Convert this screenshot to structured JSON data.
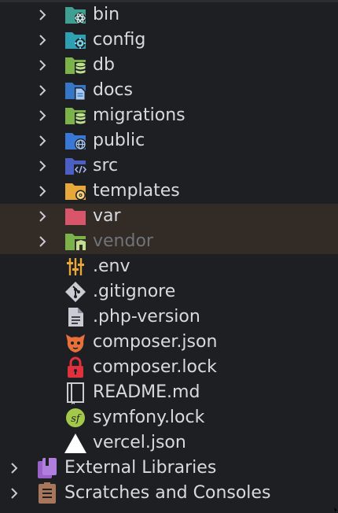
{
  "tree": {
    "folders": [
      {
        "label": "bin",
        "icon": "folder-bin-icon"
      },
      {
        "label": "config",
        "icon": "folder-config-icon"
      },
      {
        "label": "db",
        "icon": "folder-database-icon"
      },
      {
        "label": "docs",
        "icon": "folder-docs-icon"
      },
      {
        "label": "migrations",
        "icon": "folder-database-icon"
      },
      {
        "label": "public",
        "icon": "folder-public-icon"
      },
      {
        "label": "src",
        "icon": "folder-source-icon"
      },
      {
        "label": "templates",
        "icon": "folder-templates-icon"
      },
      {
        "label": "var",
        "icon": "folder-excluded-icon"
      },
      {
        "label": "vendor",
        "icon": "folder-library-icon"
      }
    ],
    "files": [
      {
        "label": ".env",
        "icon": "env-settings-icon"
      },
      {
        "label": ".gitignore",
        "icon": "git-icon"
      },
      {
        "label": ".php-version",
        "icon": "text-file-icon"
      },
      {
        "label": "composer.json",
        "icon": "composer-icon"
      },
      {
        "label": "composer.lock",
        "icon": "lock-icon"
      },
      {
        "label": "README.md",
        "icon": "readme-book-icon"
      },
      {
        "label": "symfony.lock",
        "icon": "symfony-icon"
      },
      {
        "label": "vercel.json",
        "icon": "vercel-triangle-icon"
      }
    ],
    "roots": [
      {
        "label": "External Libraries",
        "icon": "external-libraries-icon"
      },
      {
        "label": "Scratches and Consoles",
        "icon": "scratches-icon"
      }
    ]
  },
  "colors": {
    "background": "#1e1f22",
    "highlight_row": "#332b26",
    "text": "#d7dae0",
    "dim_text": "#6f737a"
  }
}
